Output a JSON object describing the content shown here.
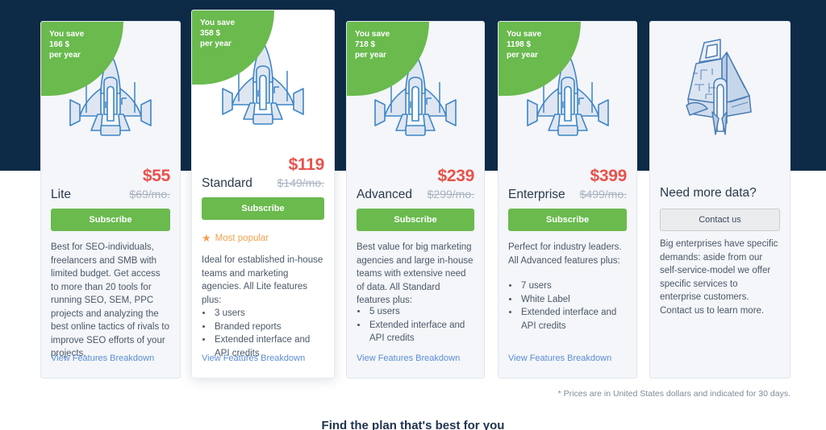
{
  "hero": {
    "band_color": "#0d2a47"
  },
  "colors": {
    "green": "#6aba4e",
    "red": "#e8524d",
    "navy": "#0d2a47",
    "link_blue": "#5a8dd6",
    "orange": "#f5a04a",
    "muted": "#a9b3c0"
  },
  "plans": [
    {
      "id": "lite",
      "save_line1": "You save",
      "save_line2": "166 $",
      "save_line3": "per year",
      "icon": "spaceship-icon",
      "price_now": "$55",
      "name": "Lite",
      "price_old": "$69/mo.",
      "subscribe_label": "Subscribe",
      "badge": "",
      "description": "Best for SEO-individuals, freelancers and SMB with limited budget. Get access to more than 20 tools for running SEO, SEM, PPC projects and analyzing the best online tactics of rivals to improve SEO efforts of your projects.",
      "features": [],
      "breakdown_label": "View Features Breakdown"
    },
    {
      "id": "standard",
      "save_line1": "You save",
      "save_line2": "358 $",
      "save_line3": "per year",
      "icon": "spaceship-icon",
      "price_now": "$119",
      "name": "Standard",
      "price_old": "$149/mo.",
      "subscribe_label": "Subscribe",
      "badge": "Most popular",
      "description": "Ideal for established in-house teams and marketing agencies. All Lite features plus:",
      "features": [
        "3 users",
        "Branded reports",
        "Extended interface and API credits"
      ],
      "breakdown_label": "View Features Breakdown"
    },
    {
      "id": "advanced",
      "save_line1": "You save",
      "save_line2": "718 $",
      "save_line3": "per year",
      "icon": "spaceship-icon",
      "price_now": "$239",
      "name": "Advanced",
      "price_old": "$299/mo.",
      "subscribe_label": "Subscribe",
      "badge": "",
      "description": "Best value for big marketing agencies and large in-house teams with extensive need of data. All Standard features plus:",
      "features": [
        "5 users",
        "Extended interface and API credits"
      ],
      "breakdown_label": "View Features Breakdown"
    },
    {
      "id": "enterprise",
      "save_line1": "You save",
      "save_line2": "1198 $",
      "save_line3": "per year",
      "icon": "spaceship-icon",
      "price_now": "$399",
      "name": "Enterprise",
      "price_old": "$499/mo.",
      "subscribe_label": "Subscribe",
      "badge": "",
      "description": "Perfect for industry leaders. All Advanced features plus:",
      "features": [
        "7 users",
        "White Label",
        "Extended interface and API credits"
      ],
      "breakdown_label": "View Features Breakdown"
    }
  ],
  "custom_card": {
    "id": "need-more-data",
    "icon": "spaceship-angled-icon",
    "title": "Need more data?",
    "button_label": "Contact us",
    "description": "Big enterprises have specific demands: aside from our self-service-model we offer specific services to enterprise customers. Contact us to learn more."
  },
  "footnote": "* Prices are in United States dollars and indicated for 30 days.",
  "bottom_heading": "Find the plan that's best for you"
}
